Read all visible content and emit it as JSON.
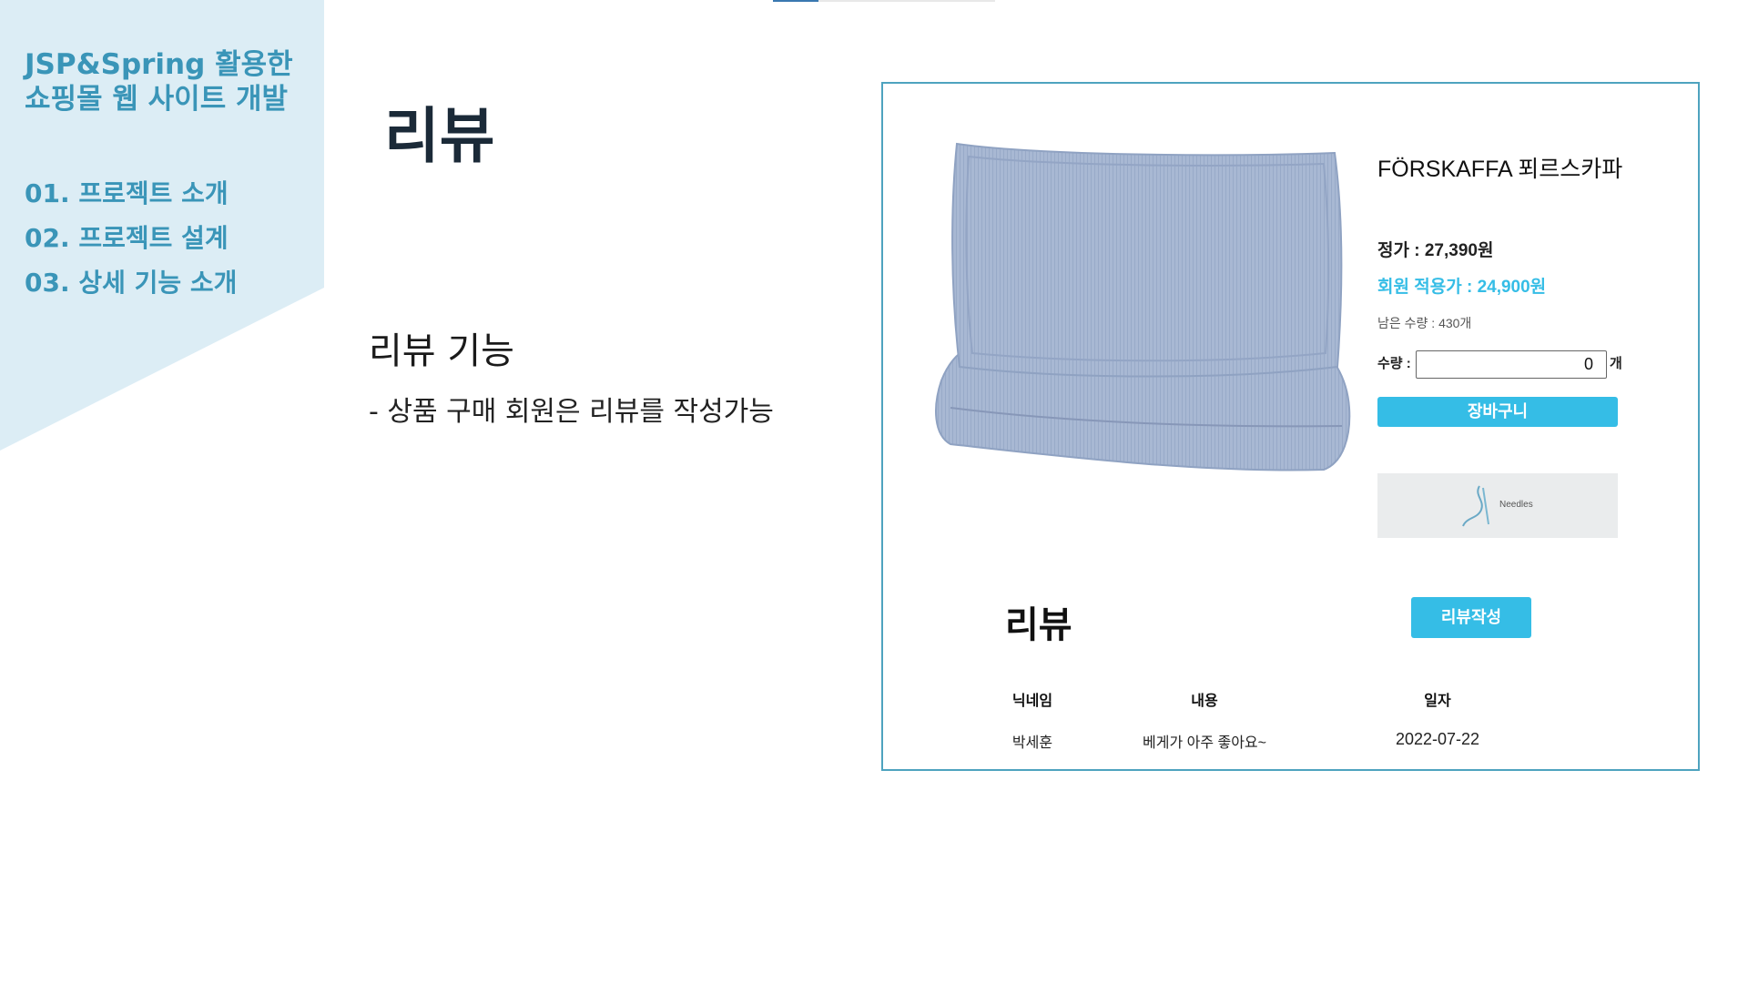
{
  "sidebar": {
    "title_line1": "JSP&Spring 활용한",
    "title_line2": "쇼핑몰 웹 사이트 개발",
    "nav": [
      {
        "label": "01. 프로젝트 소개"
      },
      {
        "label": "02. 프로젝트 설계"
      },
      {
        "label": "03. 상세 기능 소개"
      }
    ]
  },
  "slide": {
    "title": "리뷰",
    "heading": "리뷰 기능",
    "description": "- 상품 구매 회원은 리뷰를 작성가능"
  },
  "product": {
    "name": "FÖRSKAFFA 푀르스카파",
    "price_label": "정가 : 27,390원",
    "member_price_label": "회원 적용가 : 24,900원",
    "stock_label": "남은 수량 : 430개",
    "quantity_label": "수량 :",
    "quantity_value": "0",
    "quantity_unit": "개",
    "cart_button": "장바구니",
    "banner_text": "Needles"
  },
  "reviews": {
    "title": "리뷰",
    "write_button": "리뷰작성",
    "columns": [
      "닉네임",
      "내용",
      "일자"
    ],
    "rows": [
      {
        "nickname": "박세훈",
        "content": "베게가 아주 좋아요~",
        "date": "2022-07-22"
      }
    ]
  },
  "colors": {
    "accent": "#3a95b8",
    "panel_bg": "#dcedf5",
    "button": "#35bde6",
    "frame": "#4ea3bf",
    "title": "#1b2a38"
  },
  "icons": [
    "needle-thread-icon"
  ]
}
